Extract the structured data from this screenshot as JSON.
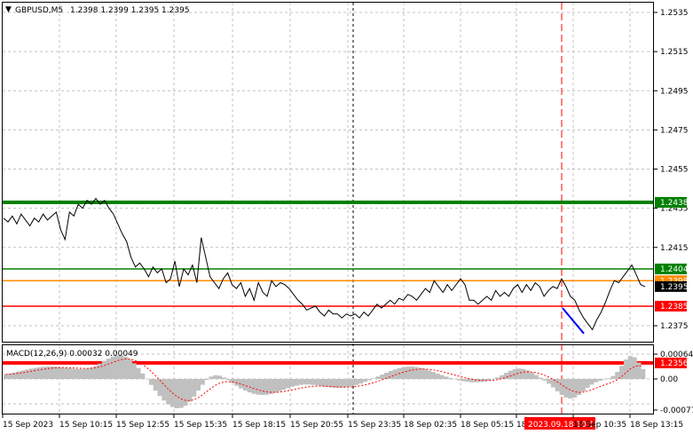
{
  "header": {
    "symbol": "GBPUSD,M5",
    "ohlc": "1.2398 1.2399 1.2395 1.2395"
  },
  "price_axis": {
    "ticks": [
      "1.2535",
      "1.2515",
      "1.2495",
      "1.2475",
      "1.2455",
      "1.2435",
      "1.2415",
      "1.2375"
    ],
    "tick_values": [
      1.2535,
      1.2515,
      1.2495,
      1.2475,
      1.2455,
      1.2435,
      1.2415,
      1.2375
    ]
  },
  "levels": [
    {
      "label": "1.2438",
      "value": 1.2438,
      "color": "#008000",
      "thick": true
    },
    {
      "label": "1.2404",
      "value": 1.2404,
      "color": "#008000",
      "thick": false
    },
    {
      "label": "1.2398",
      "value": 1.2398,
      "color": "#ff8c00",
      "thick": false,
      "hidden_behind": true
    },
    {
      "label": "1.2385",
      "value": 1.2385,
      "color": "#ff0000",
      "thick": false
    },
    {
      "label": "1.2356",
      "value": 1.2356,
      "color": "#ff0000",
      "thick": true
    }
  ],
  "current_price_label": "1.2395",
  "time_axis": {
    "labels": [
      "15 Sep 2023",
      "15 Sep 10:15",
      "15 Sep 12:55",
      "15 Sep 15:35",
      "15 Sep 18:15",
      "15 Sep 20:55",
      "15 Sep 23:35",
      "18 Sep 02:35",
      "18 Sep 05:15",
      "18 Sep 07:55",
      "2023.09.18 10:10",
      "18 Sep 10:35",
      "18 Sep 13:15"
    ],
    "highlight_label": "2023.09.18 10:10"
  },
  "macd": {
    "title": "MACD(12,26,9) 0.00032 0.00049",
    "ticks": [
      "0.00064",
      "0.00",
      "-0.00077"
    ]
  },
  "colors": {
    "grid": "#c0c0c0",
    "price_line": "#000000",
    "trend_line": "#0000ff",
    "macd_hist": "#c0c0c0",
    "macd_signal": "#ff0000",
    "vline_cursor": "#000000",
    "vline_event": "#ff0000"
  },
  "chart_data": {
    "type": "line",
    "title": "GBPUSD,M5",
    "ylim": [
      1.2355,
      1.254
    ],
    "close": [
      1.243,
      1.2428,
      1.2431,
      1.2427,
      1.2432,
      1.2429,
      1.2426,
      1.243,
      1.2428,
      1.2432,
      1.2429,
      1.2431,
      1.2433,
      1.2424,
      1.2419,
      1.2433,
      1.2431,
      1.2437,
      1.2435,
      1.2439,
      1.2437,
      1.244,
      1.2437,
      1.2439,
      1.2435,
      1.2432,
      1.2427,
      1.2422,
      1.2418,
      1.241,
      1.2405,
      1.2407,
      1.2404,
      1.24,
      1.2405,
      1.2402,
      1.2404,
      1.2397,
      1.2399,
      1.2408,
      1.2395,
      1.2404,
      1.2401,
      1.2406,
      1.2397,
      1.242,
      1.241,
      1.24,
      1.2397,
      1.2394,
      1.2399,
      1.2402,
      1.2396,
      1.2394,
      1.2397,
      1.239,
      1.2394,
      1.2388,
      1.2397,
      1.2392,
      1.239,
      1.2398,
      1.2395,
      1.2397,
      1.2396,
      1.2394,
      1.2391,
      1.2388,
      1.2386,
      1.2383,
      1.2384,
      1.2385,
      1.2382,
      1.238,
      1.2383,
      1.2381,
      1.2381,
      1.2379,
      1.2381,
      1.238,
      1.2381,
      1.2379,
      1.2382,
      1.238,
      1.2383,
      1.2386,
      1.2384,
      1.2386,
      1.2388,
      1.2386,
      1.2389,
      1.2388,
      1.2391,
      1.239,
      1.2388,
      1.2391,
      1.2394,
      1.2392,
      1.2398,
      1.2395,
      1.2392,
      1.2396,
      1.2393,
      1.2396,
      1.2399,
      1.2396,
      1.2388,
      1.2388,
      1.2386,
      1.2388,
      1.239,
      1.2388,
      1.2393,
      1.239,
      1.2392,
      1.239,
      1.2394,
      1.2396,
      1.2392,
      1.2396,
      1.2393,
      1.2397,
      1.2395,
      1.239,
      1.2393,
      1.2395,
      1.2394,
      1.2399,
      1.2395,
      1.239,
      1.2388,
      1.2383,
      1.2379,
      1.2376,
      1.2373,
      1.2378,
      1.2382,
      1.2387,
      1.2393,
      1.2398,
      1.2397,
      1.24,
      1.2403,
      1.2406,
      1.2401,
      1.2396,
      1.2395
    ]
  }
}
